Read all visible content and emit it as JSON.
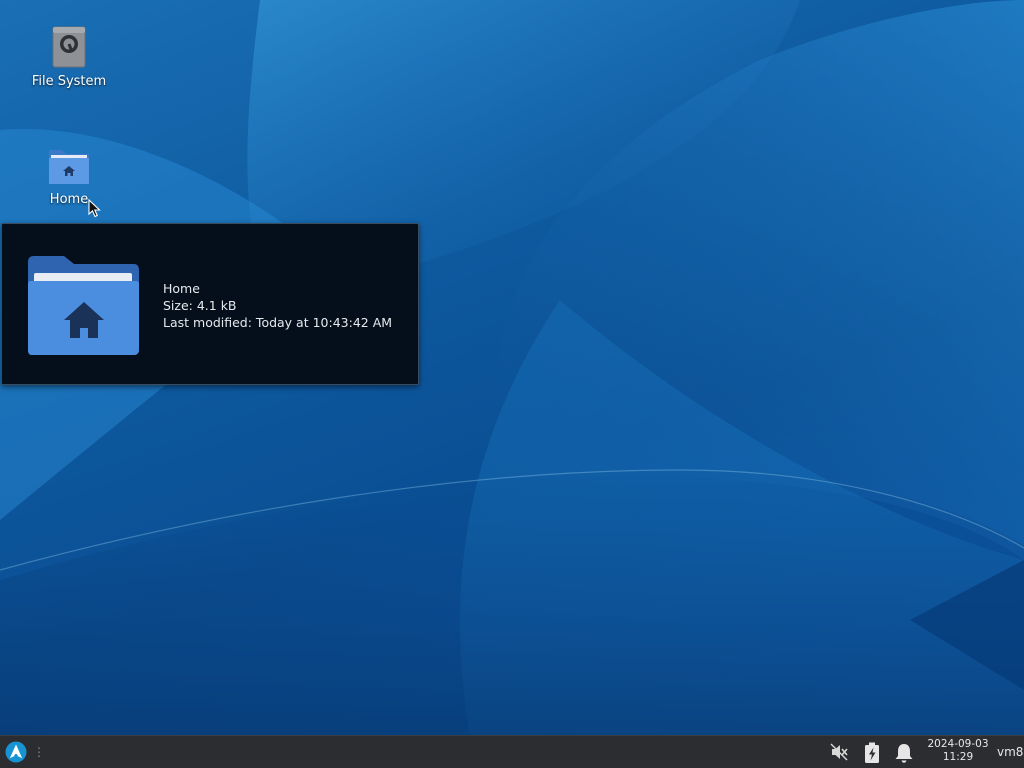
{
  "desktop": {
    "icons": [
      {
        "label": "File System",
        "icon": "drive-icon"
      },
      {
        "label": "Home",
        "icon": "home-folder-icon"
      }
    ]
  },
  "tooltip": {
    "name": "Home",
    "size": "Size: 4.1 kB",
    "modified": "Last modified: Today at 10:43:42 AM",
    "icon": "home-folder-icon"
  },
  "taskbar": {
    "app_menu_icon": "arch-logo-icon",
    "handle": "⋮",
    "tray": [
      {
        "icon": "volume-muted-icon"
      },
      {
        "icon": "battery-charging-icon"
      },
      {
        "icon": "bell-icon"
      }
    ],
    "clock": {
      "date": "2024-09-03",
      "time": "11:29"
    },
    "user": "vm8"
  },
  "colors": {
    "wallpaper_base": "#0e5aa0",
    "folder_blue": "#4b8ee0",
    "folder_dark": "#2f64b0",
    "taskbar_bg": "#2b2d30",
    "tooltip_bg": "#050f1c",
    "arch_blue": "#1793d1"
  }
}
